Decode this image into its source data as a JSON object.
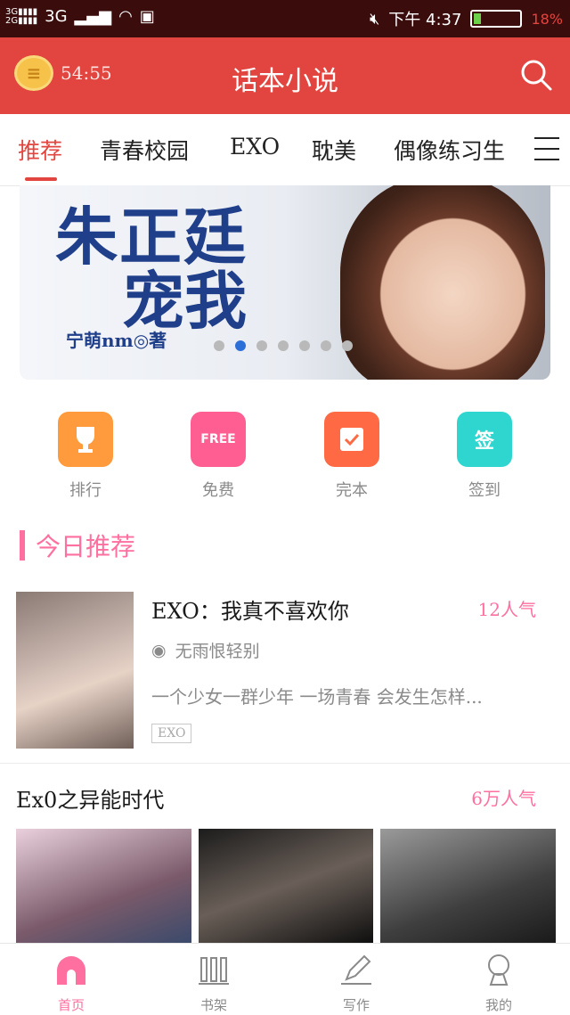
{
  "statusbar": {
    "net1": "3G",
    "time": "下午 4:37",
    "battery_pct": "18%"
  },
  "header": {
    "timer": "54:55",
    "title": "话本小说",
    "coin_glyph": "≡"
  },
  "tabs": [
    {
      "label": "推荐"
    },
    {
      "label": "青春校园"
    },
    {
      "label": "EXO"
    },
    {
      "label": "耽美"
    },
    {
      "label": "偶像练习生"
    }
  ],
  "banner": {
    "title_line1": "朱正廷",
    "title_line2": "宠我",
    "author": "宁萌nm◎著",
    "dot_count": 7,
    "active_dot": 1
  },
  "quick": [
    {
      "label": "排行",
      "icon": "trophy-icon",
      "color": "#ff9a3d"
    },
    {
      "label": "免费",
      "icon": "free-icon",
      "color": "#ff5e92"
    },
    {
      "label": "完本",
      "icon": "check-icon",
      "color": "#ff6a45"
    },
    {
      "label": "签到",
      "icon": "sign-icon",
      "color": "#2fd6cf"
    }
  ],
  "quick_glyphs": {
    "free": "FREE",
    "sign": "签"
  },
  "section": {
    "title": "今日推荐"
  },
  "book": {
    "title": "EXO：我真不喜欢你",
    "popularity": "12人气",
    "author": "无雨恨轻别",
    "description": "一个少女一群少年 一场青春 会发生怎样...",
    "tag": "EXO"
  },
  "group": {
    "title": "Ex0之异能时代",
    "popularity": "6万人气"
  },
  "bottom_nav": [
    {
      "label": "首页",
      "active": true
    },
    {
      "label": "书架",
      "active": false
    },
    {
      "label": "写作",
      "active": false
    },
    {
      "label": "我的",
      "active": false
    }
  ],
  "colors": {
    "primary": "#e2453f",
    "pink": "#ff6fa0",
    "status_bg": "#3a0c0c"
  }
}
